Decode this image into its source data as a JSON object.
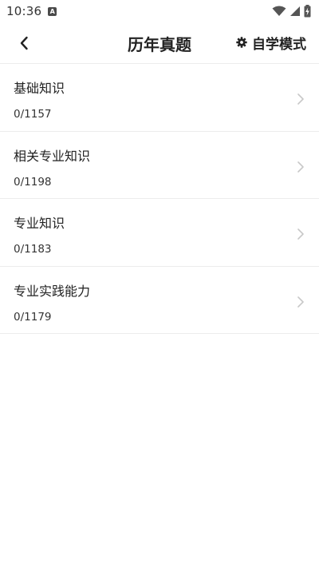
{
  "status_bar": {
    "time": "10:36",
    "app_icon": "A",
    "icons": [
      "wifi-icon",
      "signal-icon",
      "battery-charging-icon"
    ]
  },
  "header": {
    "title": "历年真题",
    "back_icon": "chevron-left-icon",
    "mode_icon": "gear-icon",
    "mode_label": "自学模式"
  },
  "items": [
    {
      "title": "基础知识",
      "progress": "0/1157"
    },
    {
      "title": "相关专业知识",
      "progress": "0/1198"
    },
    {
      "title": "专业知识",
      "progress": "0/1183"
    },
    {
      "title": "专业实践能力",
      "progress": "0/1179"
    }
  ],
  "colors": {
    "text": "#222222",
    "divider": "#ececec",
    "chevron": "#c8c8c8",
    "background": "#ffffff"
  }
}
